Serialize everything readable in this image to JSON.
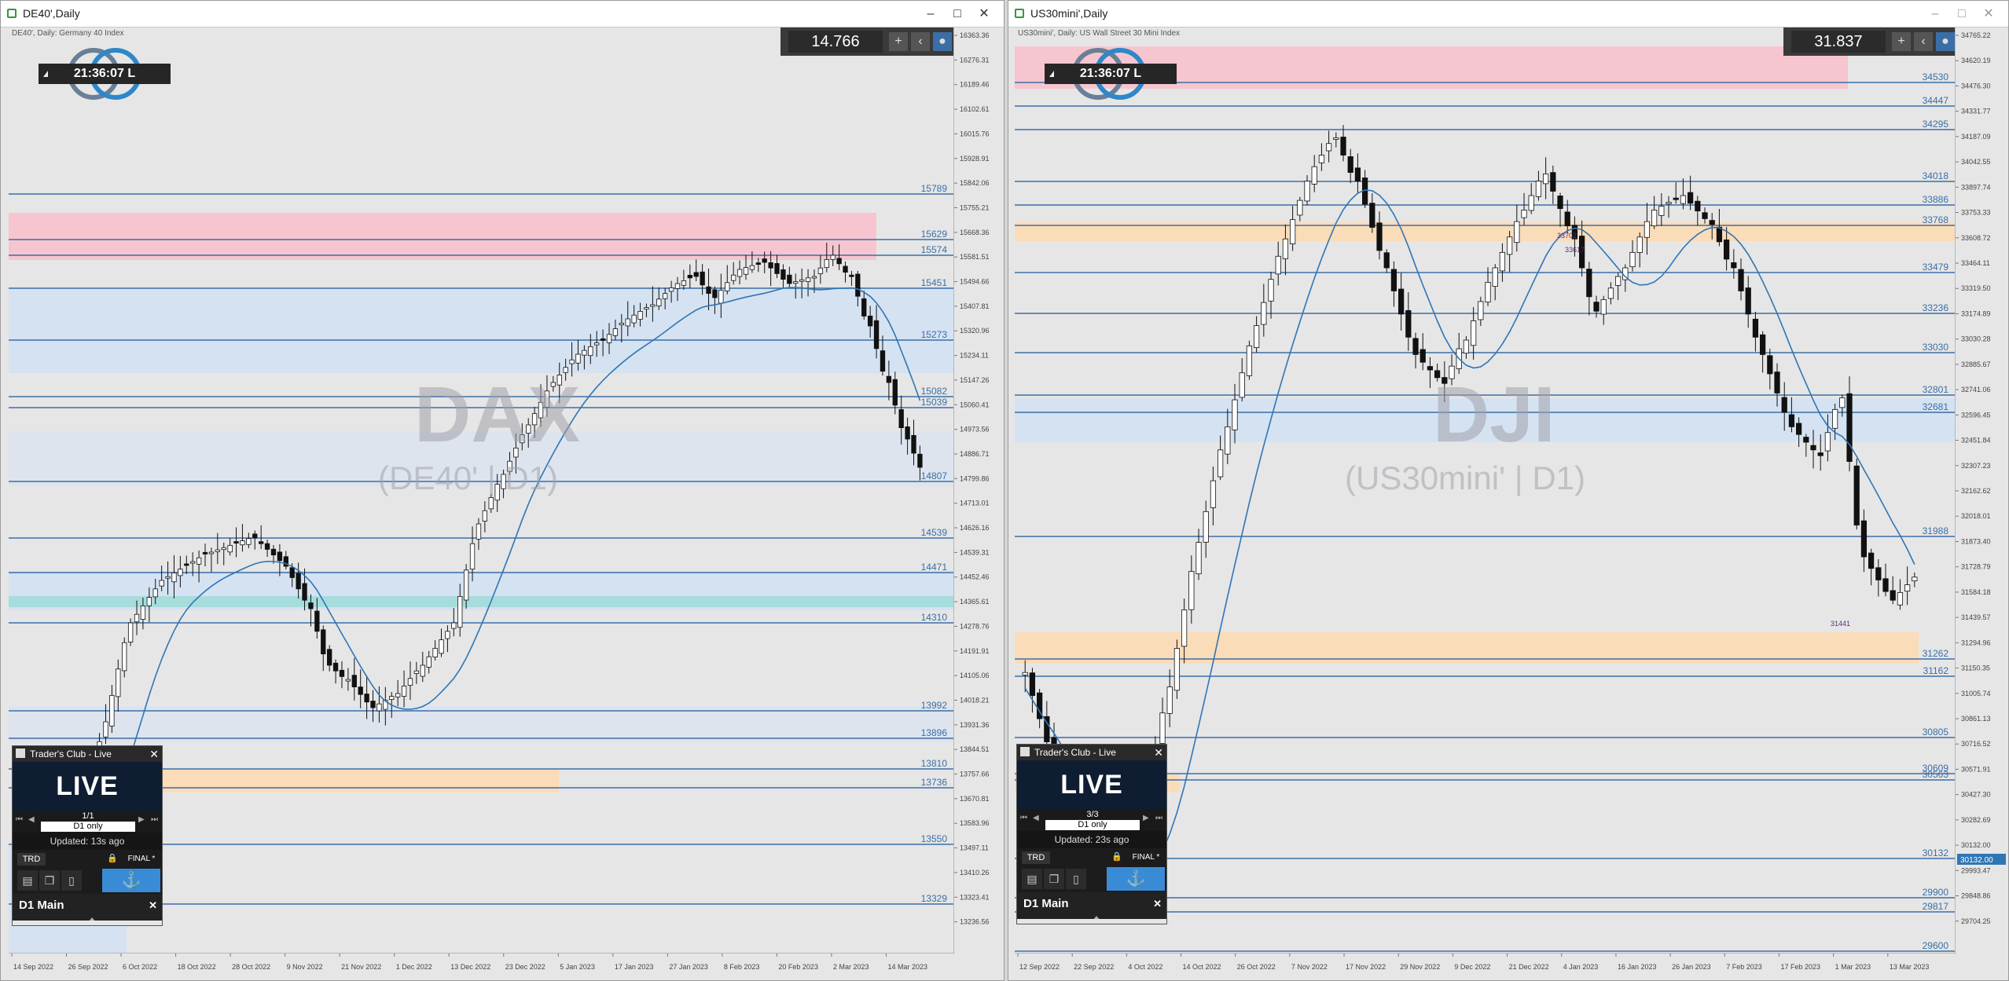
{
  "left": {
    "title": "DE40',Daily",
    "subtitle": "DE40', Daily:  Germany 40 Index",
    "clock": "21:36:07 L",
    "spread": "14.766",
    "watermark": "DAX",
    "watermark_sub": "(DE40' | D1)",
    "price_ticks": [
      "16363.36",
      "16276.31",
      "16189.46",
      "16102.61",
      "16015.76",
      "15928.91",
      "15842.06",
      "15755.21",
      "15668.36",
      "15581.51",
      "15494.66",
      "15407.81",
      "15320.96",
      "15234.11",
      "15147.26",
      "15060.41",
      "14973.56",
      "14886.71",
      "14799.86",
      "14713.01",
      "14626.16",
      "14539.31",
      "14452.46",
      "14365.61",
      "14278.76",
      "14191.91",
      "14105.06",
      "14018.21",
      "13931.36",
      "13844.51",
      "13757.66",
      "13670.81",
      "13583.96",
      "13497.11",
      "13410.26",
      "13323.41",
      "13236.56"
    ],
    "date_ticks": [
      "14 Sep 2022",
      "26 Sep 2022",
      "6 Oct 2022",
      "18 Oct 2022",
      "28 Oct 2022",
      "9 Nov 2022",
      "21 Nov 2022",
      "1 Dec 2022",
      "13 Dec 2022",
      "23 Dec 2022",
      "5 Jan 2023",
      "17 Jan 2023",
      "27 Jan 2023",
      "8 Feb 2023",
      "20 Feb 2023",
      "2 Mar 2023",
      "14 Mar 2023"
    ],
    "levels": [
      "15789",
      "15629",
      "15574",
      "15451",
      "15273",
      "15082",
      "15039",
      "14807",
      "14539",
      "14471",
      "14310",
      "13992",
      "13896",
      "13810",
      "13736",
      "13550",
      "13329"
    ],
    "traders_club": {
      "title": "Trader's Club - Live",
      "live": "LIVE",
      "page": "1/1",
      "filter": "D1 only",
      "updated": "Updated: 13s ago",
      "trd": "TRD",
      "final": "FINAL *",
      "main": "D1 Main"
    }
  },
  "right": {
    "title": "US30mini',Daily",
    "subtitle": "US30mini', Daily:  US Wall Street 30 Mini Index",
    "clock": "21:36:07 L",
    "spread": "31.837",
    "watermark": "DJI",
    "watermark_sub": "(US30mini' | D1)",
    "price_ticks": [
      "34765.22",
      "34620.19",
      "34476.30",
      "34331.77",
      "34187.09",
      "34042.55",
      "33897.74",
      "33753.33",
      "33608.72",
      "33464.11",
      "33319.50",
      "33174.89",
      "33030.28",
      "32885.67",
      "32741.06",
      "32596.45",
      "32451.84",
      "32307.23",
      "32162.62",
      "32018.01",
      "31873.40",
      "31728.79",
      "31584.18",
      "31439.57",
      "31294.96",
      "31150.35",
      "31005.74",
      "30861.13",
      "30716.52",
      "30571.91",
      "30427.30",
      "30282.69",
      "30132.00",
      "29993.47",
      "29848.86",
      "29704.25"
    ],
    "date_ticks": [
      "12 Sep 2022",
      "22 Sep 2022",
      "4 Oct 2022",
      "14 Oct 2022",
      "26 Oct 2022",
      "7 Nov 2022",
      "17 Nov 2022",
      "29 Nov 2022",
      "9 Dec 2022",
      "21 Dec 2022",
      "4 Jan 2023",
      "16 Jan 2023",
      "26 Jan 2023",
      "7 Feb 2023",
      "17 Feb 2023",
      "1 Mar 2023",
      "13 Mar 2023"
    ],
    "levels": [
      "34530",
      "34447",
      "34295",
      "34018",
      "33886",
      "33768",
      "33479",
      "33236",
      "33030",
      "32801",
      "32681",
      "31988",
      "31262",
      "31162",
      "30805",
      "30609",
      "30563",
      "30132",
      "29900",
      "29817",
      "29600"
    ],
    "small_labels": [
      "33702",
      "33617",
      "31441"
    ],
    "price_badge": "30132.00",
    "traders_club": {
      "title": "Trader's Club - Live",
      "live": "LIVE",
      "page": "3/3",
      "filter": "D1 only",
      "updated": "Updated: 23s ago",
      "trd": "TRD",
      "final": "FINAL *",
      "main": "D1 Main"
    }
  }
}
